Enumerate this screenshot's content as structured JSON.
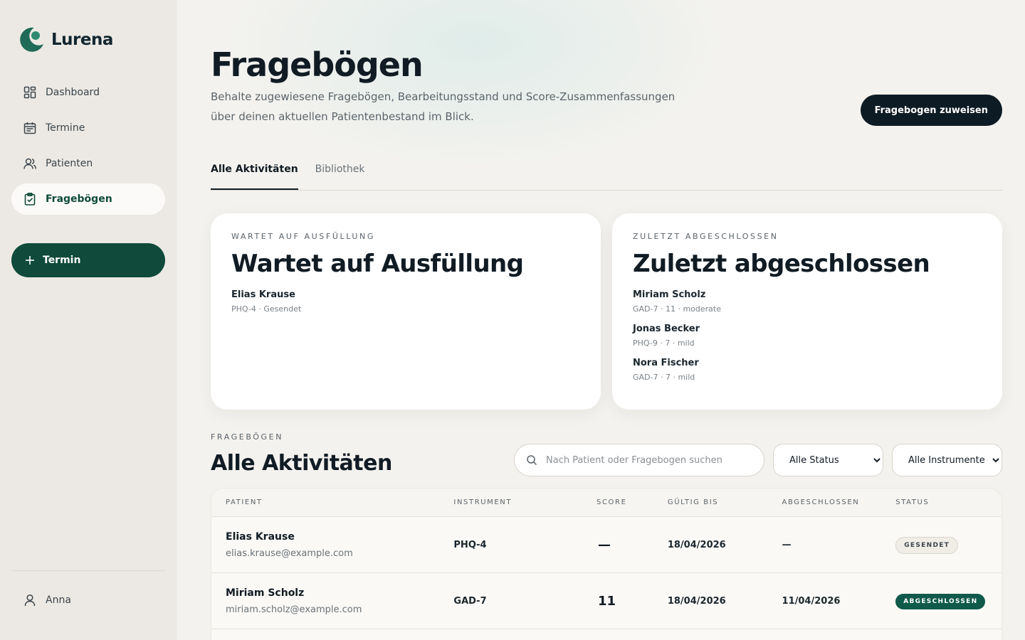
{
  "app": {
    "name": "Lurena"
  },
  "sidebar": {
    "items": [
      {
        "label": "Dashboard",
        "icon": "grid-icon"
      },
      {
        "label": "Termine",
        "icon": "calendar-icon"
      },
      {
        "label": "Patienten",
        "icon": "users-icon"
      },
      {
        "label": "Fragebögen",
        "icon": "clipboard-icon",
        "active": true
      }
    ],
    "add_label": "Termin",
    "user_name": "Anna"
  },
  "header": {
    "title": "Fragebögen",
    "subtitle": "Behalte zugewiesene Fragebögen, Bearbeitungsstand und Score-Zusammenfassungen über deinen aktuellen Patientenbestand im Blick.",
    "assign_label": "Fragebogen zuweisen"
  },
  "tabs": [
    {
      "label": "Alle Aktivitäten",
      "active": true
    },
    {
      "label": "Bibliothek",
      "active": false
    }
  ],
  "cards": {
    "pending": {
      "eyebrow": "WARTET AUF AUSFÜLLUNG",
      "title": "Wartet auf Ausfüllung",
      "items": [
        {
          "name": "Elias Krause",
          "meta": "PHQ-4 · Gesendet"
        }
      ]
    },
    "completed": {
      "eyebrow": "ZULETZT ABGESCHLOSSEN",
      "title": "Zuletzt abgeschlossen",
      "items": [
        {
          "name": "Miriam Scholz",
          "meta": "GAD-7 · 11 · moderate"
        },
        {
          "name": "Jonas Becker",
          "meta": "PHQ-9 · 7 · mild"
        },
        {
          "name": "Nora Fischer",
          "meta": "GAD-7 · 7 · mild"
        }
      ]
    }
  },
  "section": {
    "eyebrow": "FRAGEBÖGEN",
    "title": "Alle Aktivitäten",
    "search_placeholder": "Nach Patient oder Fragebogen suchen",
    "status_filter": "Alle Status",
    "instrument_filter": "Alle Instrumente"
  },
  "table": {
    "columns": [
      "PATIENT",
      "INSTRUMENT",
      "SCORE",
      "GÜLTIG BIS",
      "ABGESCHLOSSEN",
      "STATUS"
    ],
    "rows": [
      {
        "name": "Elias Krause",
        "email": "elias.krause@example.com",
        "instrument": "PHQ-4",
        "score": "—",
        "valid_until": "18/04/2026",
        "completed": "—",
        "status": "GESENDET",
        "status_kind": "sent"
      },
      {
        "name": "Miriam Scholz",
        "email": "miriam.scholz@example.com",
        "instrument": "GAD-7",
        "score": "11",
        "valid_until": "18/04/2026",
        "completed": "11/04/2026",
        "status": "ABGESCHLOSSEN",
        "status_kind": "done"
      }
    ]
  },
  "colors": {
    "brand": "#0f4a3a",
    "dark": "#0d1b24",
    "badge_done": "#0f5a4a"
  }
}
